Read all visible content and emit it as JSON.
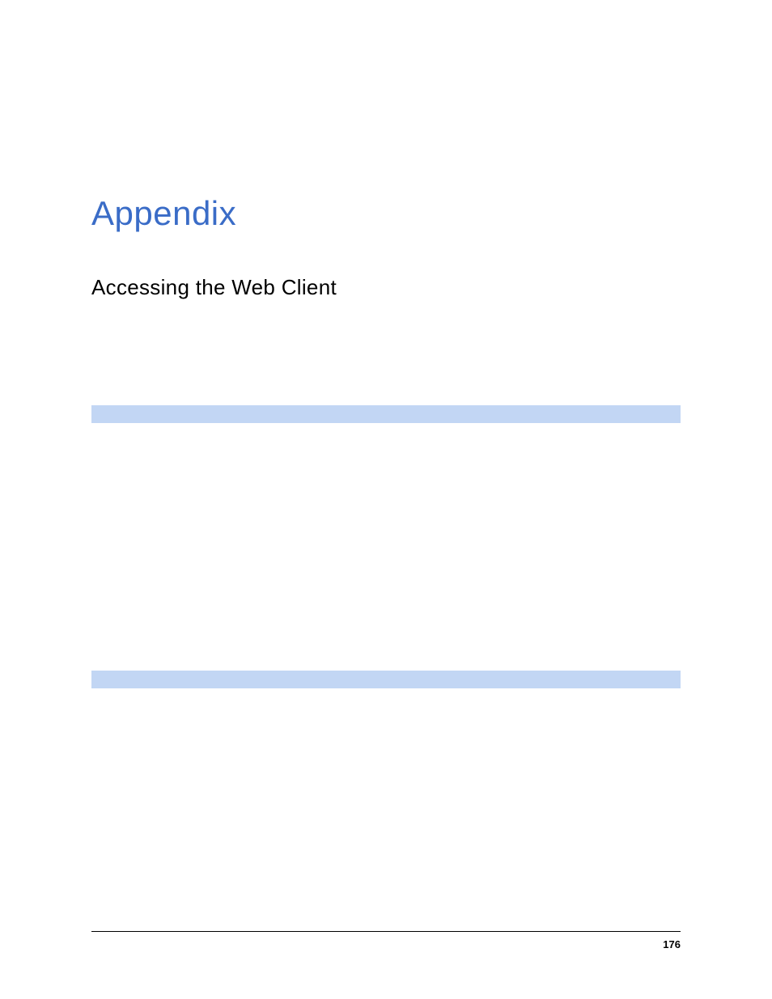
{
  "page": {
    "title": "Appendix",
    "subtitle": "Accessing the Web Client",
    "page_number": "176"
  }
}
